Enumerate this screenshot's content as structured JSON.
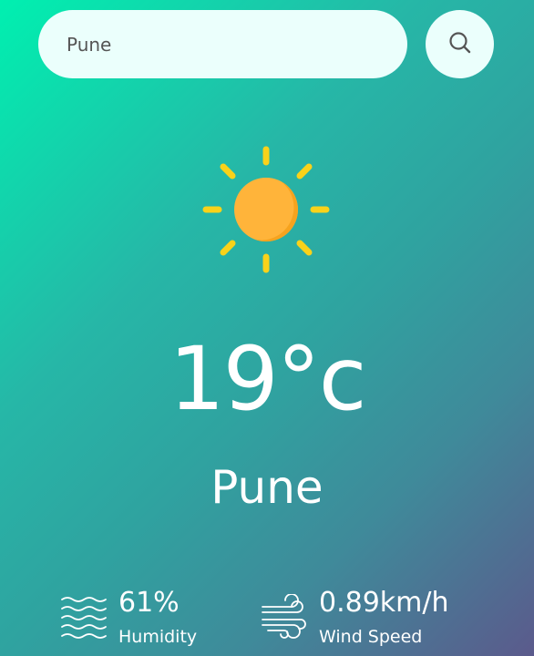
{
  "search": {
    "value": "Pune",
    "icon": "search-icon"
  },
  "weather": {
    "icon": "sun-icon",
    "temperature": "19°c",
    "city": "Pune"
  },
  "details": {
    "humidity": {
      "value": "61%",
      "label": "Humidity",
      "icon": "humidity-icon"
    },
    "wind": {
      "value": "0.89km/h",
      "label": "Wind Speed",
      "icon": "wind-icon"
    }
  },
  "colors": {
    "sun": "#ffb43a",
    "sun_rays": "#f9d21a",
    "gradient_start": "#00f0b0",
    "gradient_end": "#5b5a8c",
    "search_bg": "#ebfffc"
  }
}
